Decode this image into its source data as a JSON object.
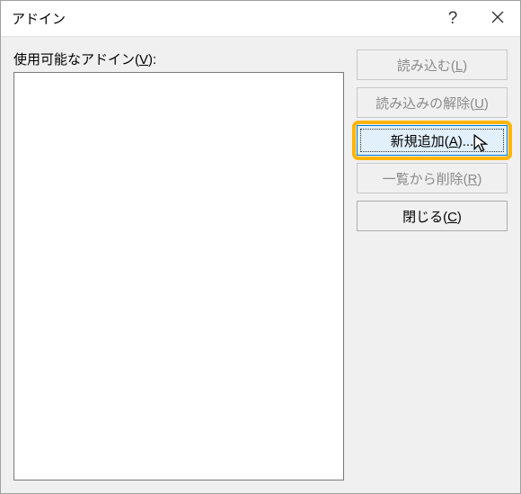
{
  "titlebar": {
    "title": "アドイン"
  },
  "listLabel": {
    "prefix": "使用可能なアドイン(",
    "mnemonic": "V",
    "suffix": "):"
  },
  "buttons": {
    "load": {
      "prefix": "読み込む(",
      "mnemonic": "L",
      "suffix": ")"
    },
    "unload": {
      "prefix": "読み込みの解除(",
      "mnemonic": "U",
      "suffix": ")"
    },
    "add": {
      "prefix": "新規追加(",
      "mnemonic": "A",
      "suffix": ")..."
    },
    "remove": {
      "prefix": "一覧から削除(",
      "mnemonic": "R",
      "suffix": ")"
    },
    "close": {
      "prefix": "閉じる(",
      "mnemonic": "C",
      "suffix": ")"
    }
  }
}
